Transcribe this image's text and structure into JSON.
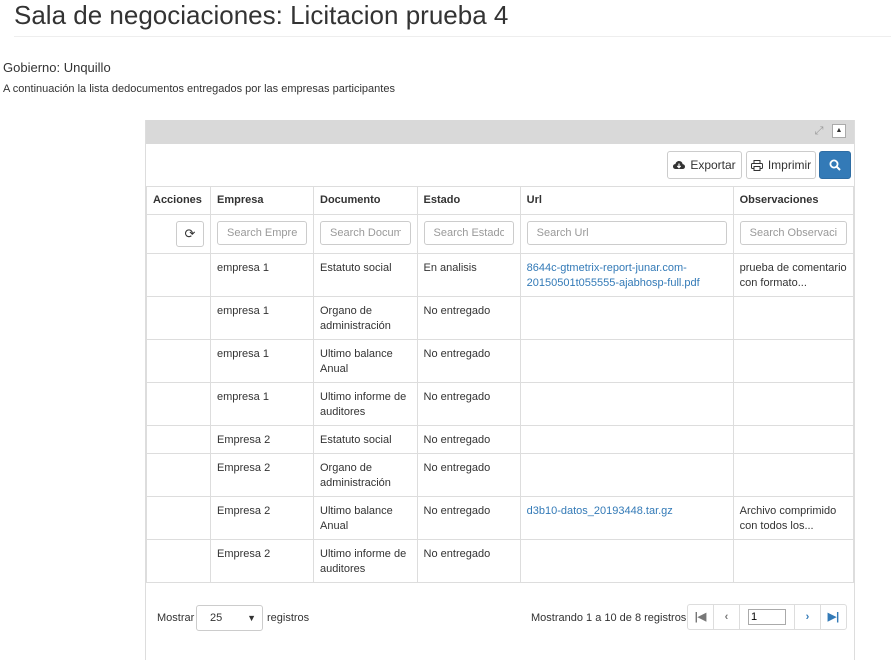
{
  "page": {
    "title": "Sala de negociaciones: Licitacion prueba 4",
    "government": "Gobierno: Unquillo",
    "intro": "A continuación la lista dedocumentos entregados por las empresas participantes"
  },
  "toolbar": {
    "export_label": "Exportar",
    "print_label": "Imprimir"
  },
  "table": {
    "columns": [
      "Acciones",
      "Empresa",
      "Documento",
      "Estado",
      "Url",
      "Observaciones"
    ],
    "placeholders": {
      "empresa": "Search Empresa",
      "documento": "Search Documento",
      "estado": "Search Estado",
      "url": "Search Url",
      "observaciones": "Search Observaciones"
    },
    "rows": [
      {
        "empresa": "empresa 1",
        "documento": "Estatuto social",
        "estado": "En analisis",
        "url": "8644c-gtmetrix-report-junar.com-20150501t055555-ajabhosp-full.pdf",
        "obs": "prueba de comentario con formato..."
      },
      {
        "empresa": "empresa 1",
        "documento": "Organo de administración",
        "estado": "No entregado",
        "url": "",
        "obs": ""
      },
      {
        "empresa": "empresa 1",
        "documento": "Ultimo balance Anual",
        "estado": "No entregado",
        "url": "",
        "obs": ""
      },
      {
        "empresa": "empresa 1",
        "documento": "Ultimo informe de auditores",
        "estado": "No entregado",
        "url": "",
        "obs": ""
      },
      {
        "empresa": "Empresa 2",
        "documento": "Estatuto social",
        "estado": "No entregado",
        "url": "",
        "obs": ""
      },
      {
        "empresa": "Empresa 2",
        "documento": "Organo de administración",
        "estado": "No entregado",
        "url": "",
        "obs": ""
      },
      {
        "empresa": "Empresa 2",
        "documento": "Ultimo balance Anual",
        "estado": "No entregado",
        "url": "d3b10-datos_20193448.tar.gz",
        "obs": "Archivo comprimido con todos los..."
      },
      {
        "empresa": "Empresa 2",
        "documento": "Ultimo informe de auditores",
        "estado": "No entregado",
        "url": "",
        "obs": ""
      }
    ]
  },
  "footer": {
    "show_label": "Mostrar",
    "page_size": "25",
    "records_label": "registros",
    "info": "Mostrando 1 a 10 de 8 registros",
    "current_page": "1"
  },
  "colors": {
    "accent": "#337ab7",
    "link": "#337ab7",
    "panel_header": "#d9d9d9"
  },
  "icons": [
    "expand-icon",
    "collapse-icon",
    "cloud-download-icon",
    "print-icon",
    "search-icon",
    "refresh-icon",
    "first-page-icon",
    "prev-page-icon",
    "next-page-icon",
    "last-page-icon",
    "caret-down-icon"
  ]
}
